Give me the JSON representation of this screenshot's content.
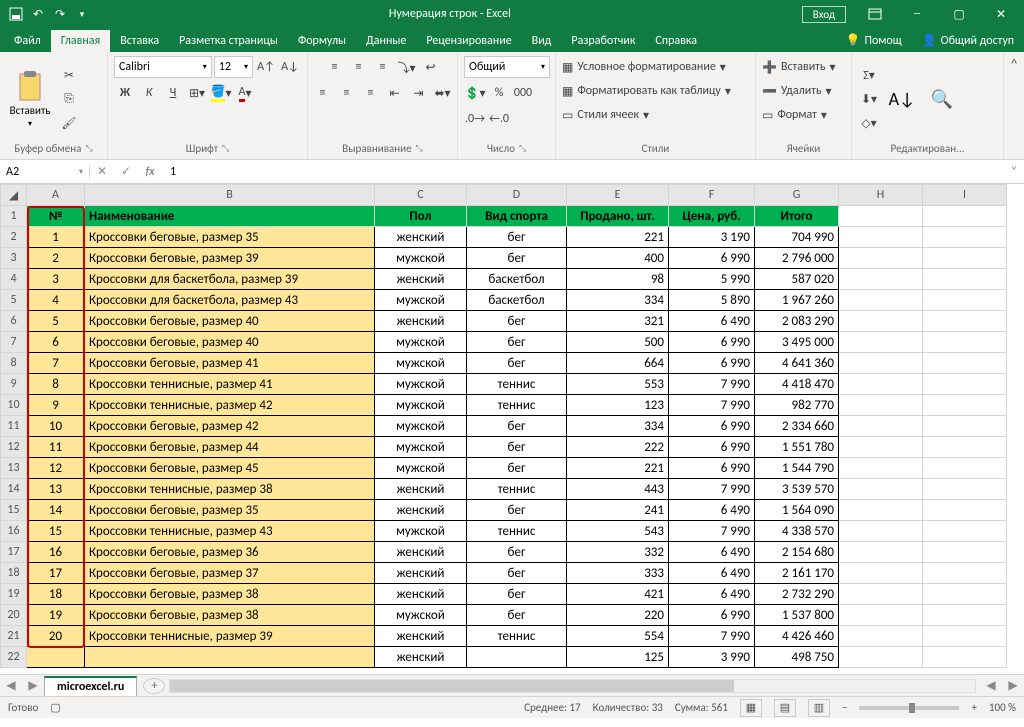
{
  "titlebar": {
    "title": "Нумерация строк  -  Excel",
    "login": "Вход"
  },
  "tabs": {
    "file": "Файл",
    "home": "Главная",
    "insert": "Вставка",
    "page_layout": "Разметка страницы",
    "formulas": "Формулы",
    "data": "Данные",
    "review": "Рецензирование",
    "view": "Вид",
    "developer": "Разработчик",
    "help": "Справка",
    "tell_me": "Помощ",
    "share": "Общий доступ"
  },
  "ribbon": {
    "clipboard": {
      "paste": "Вставить",
      "label": "Буфер обмена"
    },
    "font": {
      "name": "Calibri",
      "size": "12",
      "label": "Шрифт",
      "bold": "Ж",
      "italic": "К",
      "underline": "Ч"
    },
    "alignment": {
      "label": "Выравнивание"
    },
    "number": {
      "format": "Общий",
      "label": "Число"
    },
    "styles": {
      "conditional": "Условное форматирование",
      "as_table": "Форматировать как таблицу",
      "cell_styles": "Стили ячеек",
      "label": "Стили"
    },
    "cells": {
      "insert": "Вставить",
      "delete": "Удалить",
      "format": "Формат",
      "label": "Ячейки"
    },
    "editing": {
      "label": "Редактирован..."
    }
  },
  "formula_bar": {
    "namebox": "A2",
    "formula": "1"
  },
  "columns": [
    "A",
    "B",
    "C",
    "D",
    "E",
    "F",
    "G",
    "H",
    "I"
  ],
  "header_row": {
    "num": "№",
    "name": "Наименование",
    "gender": "Пол",
    "sport": "Вид спорта",
    "sold": "Продано, шт.",
    "price": "Цена, руб.",
    "total": "Итого"
  },
  "rows": [
    {
      "n": "1",
      "name": "Кроссовки беговые, размер 35",
      "g": "женский",
      "s": "бег",
      "sold": "221",
      "price": "3 190",
      "total": "704 990"
    },
    {
      "n": "2",
      "name": "Кроссовки беговые, размер 39",
      "g": "мужской",
      "s": "бег",
      "sold": "400",
      "price": "6 990",
      "total": "2 796 000"
    },
    {
      "n": "3",
      "name": "Кроссовки для баскетбола, размер 39",
      "g": "женский",
      "s": "баскетбол",
      "sold": "98",
      "price": "5 990",
      "total": "587 020"
    },
    {
      "n": "4",
      "name": "Кроссовки для баскетбола, размер 43",
      "g": "мужской",
      "s": "баскетбол",
      "sold": "334",
      "price": "5 890",
      "total": "1 967 260"
    },
    {
      "n": "5",
      "name": "Кроссовки беговые, размер 40",
      "g": "женский",
      "s": "бег",
      "sold": "321",
      "price": "6 490",
      "total": "2 083 290"
    },
    {
      "n": "6",
      "name": "Кроссовки беговые, размер 40",
      "g": "мужской",
      "s": "бег",
      "sold": "500",
      "price": "6 990",
      "total": "3 495 000"
    },
    {
      "n": "7",
      "name": "Кроссовки беговые, размер 41",
      "g": "мужской",
      "s": "бег",
      "sold": "664",
      "price": "6 990",
      "total": "4 641 360"
    },
    {
      "n": "8",
      "name": "Кроссовки теннисные, размер 41",
      "g": "мужской",
      "s": "теннис",
      "sold": "553",
      "price": "7 990",
      "total": "4 418 470"
    },
    {
      "n": "9",
      "name": "Кроссовки теннисные, размер 42",
      "g": "мужской",
      "s": "теннис",
      "sold": "123",
      "price": "7 990",
      "total": "982 770"
    },
    {
      "n": "10",
      "name": "Кроссовки беговые, размер 42",
      "g": "мужской",
      "s": "бег",
      "sold": "334",
      "price": "6 990",
      "total": "2 334 660"
    },
    {
      "n": "11",
      "name": "Кроссовки беговые, размер 44",
      "g": "мужской",
      "s": "бег",
      "sold": "222",
      "price": "6 990",
      "total": "1 551 780"
    },
    {
      "n": "12",
      "name": "Кроссовки беговые, размер 45",
      "g": "мужской",
      "s": "бег",
      "sold": "221",
      "price": "6 990",
      "total": "1 544 790"
    },
    {
      "n": "13",
      "name": "Кроссовки теннисные, размер 38",
      "g": "женский",
      "s": "теннис",
      "sold": "443",
      "price": "7 990",
      "total": "3 539 570"
    },
    {
      "n": "14",
      "name": "Кроссовки беговые, размер 35",
      "g": "женский",
      "s": "бег",
      "sold": "241",
      "price": "6 490",
      "total": "1 564 090"
    },
    {
      "n": "15",
      "name": "Кроссовки теннисные, размер 43",
      "g": "мужской",
      "s": "теннис",
      "sold": "543",
      "price": "7 990",
      "total": "4 338 570"
    },
    {
      "n": "16",
      "name": "Кроссовки беговые, размер 36",
      "g": "женский",
      "s": "бег",
      "sold": "332",
      "price": "6 490",
      "total": "2 154 680"
    },
    {
      "n": "17",
      "name": "Кроссовки беговые, размер 37",
      "g": "женский",
      "s": "бег",
      "sold": "333",
      "price": "6 490",
      "total": "2 161 170"
    },
    {
      "n": "18",
      "name": "Кроссовки беговые, размер 38",
      "g": "женский",
      "s": "бег",
      "sold": "421",
      "price": "6 490",
      "total": "2 732 290"
    },
    {
      "n": "19",
      "name": "Кроссовки беговые, размер 38",
      "g": "мужской",
      "s": "бег",
      "sold": "220",
      "price": "6 990",
      "total": "1 537 800"
    },
    {
      "n": "20",
      "name": "Кроссовки теннисные, размер 39",
      "g": "женский",
      "s": "теннис",
      "sold": "554",
      "price": "7 990",
      "total": "4 426 460"
    }
  ],
  "partial_row": {
    "g": "женский",
    "sold": "125",
    "price": "3 990",
    "total": "498 750"
  },
  "sheet": {
    "name": "microexcel.ru"
  },
  "statusbar": {
    "ready": "Готово",
    "avg_label": "Среднее:",
    "avg": "17",
    "count_label": "Количество:",
    "count": "33",
    "sum_label": "Сумма:",
    "sum": "561",
    "zoom": "100 %"
  }
}
